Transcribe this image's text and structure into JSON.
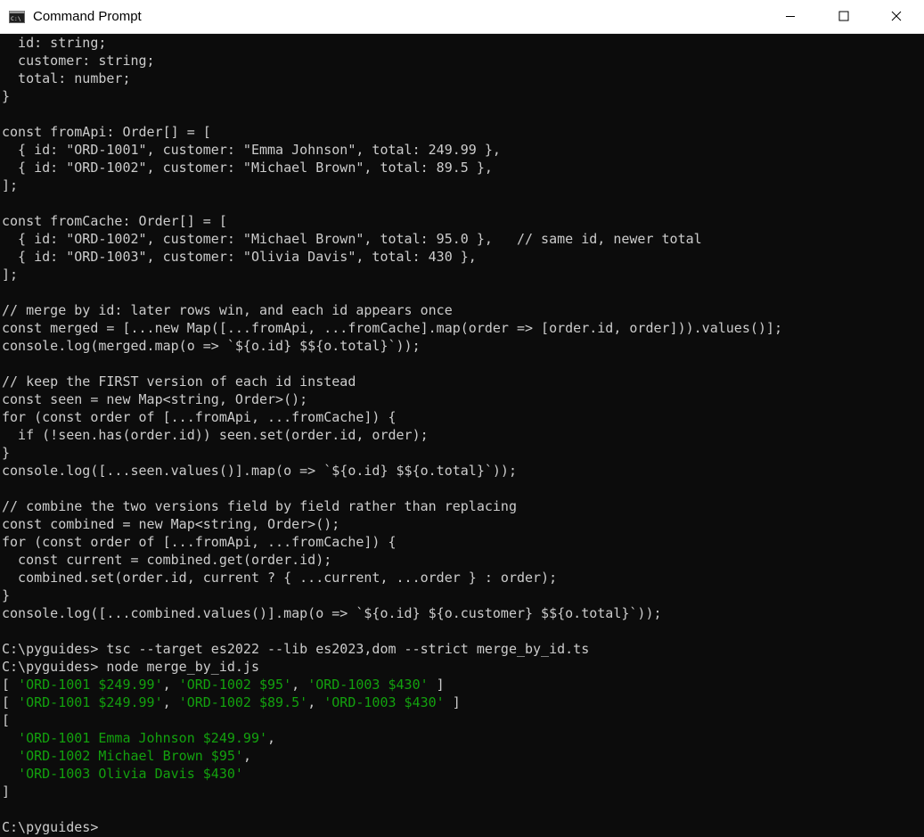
{
  "window": {
    "title": "Command Prompt",
    "icons": {
      "app": "command-prompt-icon",
      "minimize": "minimize-icon",
      "maximize": "maximize-icon",
      "close": "close-icon"
    },
    "colors": {
      "titlebar_bg": "#ffffff",
      "console_bg": "#0c0c0c",
      "text": "#cccccc",
      "string_output": "#13a10e"
    }
  },
  "console": {
    "lines": [
      {
        "segments": [
          {
            "text": "  id: string;"
          }
        ]
      },
      {
        "segments": [
          {
            "text": "  customer: string;"
          }
        ]
      },
      {
        "segments": [
          {
            "text": "  total: number;"
          }
        ]
      },
      {
        "segments": [
          {
            "text": "}"
          }
        ]
      },
      {
        "segments": [
          {
            "text": ""
          }
        ]
      },
      {
        "segments": [
          {
            "text": "const fromApi: Order[] = ["
          }
        ]
      },
      {
        "segments": [
          {
            "text": "  { id: \"ORD-1001\", customer: \"Emma Johnson\", total: 249.99 },"
          }
        ]
      },
      {
        "segments": [
          {
            "text": "  { id: \"ORD-1002\", customer: \"Michael Brown\", total: 89.5 },"
          }
        ]
      },
      {
        "segments": [
          {
            "text": "];"
          }
        ]
      },
      {
        "segments": [
          {
            "text": ""
          }
        ]
      },
      {
        "segments": [
          {
            "text": "const fromCache: Order[] = ["
          }
        ]
      },
      {
        "segments": [
          {
            "text": "  { id: \"ORD-1002\", customer: \"Michael Brown\", total: 95.0 },   // same id, newer total"
          }
        ]
      },
      {
        "segments": [
          {
            "text": "  { id: \"ORD-1003\", customer: \"Olivia Davis\", total: 430 },"
          }
        ]
      },
      {
        "segments": [
          {
            "text": "];"
          }
        ]
      },
      {
        "segments": [
          {
            "text": ""
          }
        ]
      },
      {
        "segments": [
          {
            "text": "// merge by id: later rows win, and each id appears once"
          }
        ]
      },
      {
        "segments": [
          {
            "text": "const merged = [...new Map([...fromApi, ...fromCache].map(order => [order.id, order])).values()];"
          }
        ]
      },
      {
        "segments": [
          {
            "text": "console.log(merged.map(o => `${o.id} $${o.total}`));"
          }
        ]
      },
      {
        "segments": [
          {
            "text": ""
          }
        ]
      },
      {
        "segments": [
          {
            "text": "// keep the FIRST version of each id instead"
          }
        ]
      },
      {
        "segments": [
          {
            "text": "const seen = new Map<string, Order>();"
          }
        ]
      },
      {
        "segments": [
          {
            "text": "for (const order of [...fromApi, ...fromCache]) {"
          }
        ]
      },
      {
        "segments": [
          {
            "text": "  if (!seen.has(order.id)) seen.set(order.id, order);"
          }
        ]
      },
      {
        "segments": [
          {
            "text": "}"
          }
        ]
      },
      {
        "segments": [
          {
            "text": "console.log([...seen.values()].map(o => `${o.id} $${o.total}`));"
          }
        ]
      },
      {
        "segments": [
          {
            "text": ""
          }
        ]
      },
      {
        "segments": [
          {
            "text": "// combine the two versions field by field rather than replacing"
          }
        ]
      },
      {
        "segments": [
          {
            "text": "const combined = new Map<string, Order>();"
          }
        ]
      },
      {
        "segments": [
          {
            "text": "for (const order of [...fromApi, ...fromCache]) {"
          }
        ]
      },
      {
        "segments": [
          {
            "text": "  const current = combined.get(order.id);"
          }
        ]
      },
      {
        "segments": [
          {
            "text": "  combined.set(order.id, current ? { ...current, ...order } : order);"
          }
        ]
      },
      {
        "segments": [
          {
            "text": "}"
          }
        ]
      },
      {
        "segments": [
          {
            "text": "console.log([...combined.values()].map(o => `${o.id} ${o.customer} $${o.total}`));"
          }
        ]
      },
      {
        "segments": [
          {
            "text": ""
          }
        ]
      },
      {
        "segments": [
          {
            "text": "C:\\pyguides> tsc --target es2022 --lib es2023,dom --strict merge_by_id.ts"
          }
        ]
      },
      {
        "segments": [
          {
            "text": "C:\\pyguides> node merge_by_id.js"
          }
        ]
      },
      {
        "segments": [
          {
            "text": "[ "
          },
          {
            "text": "'ORD-1001 $249.99'",
            "color": "green"
          },
          {
            "text": ", "
          },
          {
            "text": "'ORD-1002 $95'",
            "color": "green"
          },
          {
            "text": ", "
          },
          {
            "text": "'ORD-1003 $430'",
            "color": "green"
          },
          {
            "text": " ]"
          }
        ]
      },
      {
        "segments": [
          {
            "text": "[ "
          },
          {
            "text": "'ORD-1001 $249.99'",
            "color": "green"
          },
          {
            "text": ", "
          },
          {
            "text": "'ORD-1002 $89.5'",
            "color": "green"
          },
          {
            "text": ", "
          },
          {
            "text": "'ORD-1003 $430'",
            "color": "green"
          },
          {
            "text": " ]"
          }
        ]
      },
      {
        "segments": [
          {
            "text": "["
          }
        ]
      },
      {
        "segments": [
          {
            "text": "  "
          },
          {
            "text": "'ORD-1001 Emma Johnson $249.99'",
            "color": "green"
          },
          {
            "text": ","
          }
        ]
      },
      {
        "segments": [
          {
            "text": "  "
          },
          {
            "text": "'ORD-1002 Michael Brown $95'",
            "color": "green"
          },
          {
            "text": ","
          }
        ]
      },
      {
        "segments": [
          {
            "text": "  "
          },
          {
            "text": "'ORD-1003 Olivia Davis $430'",
            "color": "green"
          }
        ]
      },
      {
        "segments": [
          {
            "text": "]"
          }
        ]
      },
      {
        "segments": [
          {
            "text": ""
          }
        ]
      },
      {
        "segments": [
          {
            "text": "C:\\pyguides>"
          }
        ]
      }
    ]
  }
}
